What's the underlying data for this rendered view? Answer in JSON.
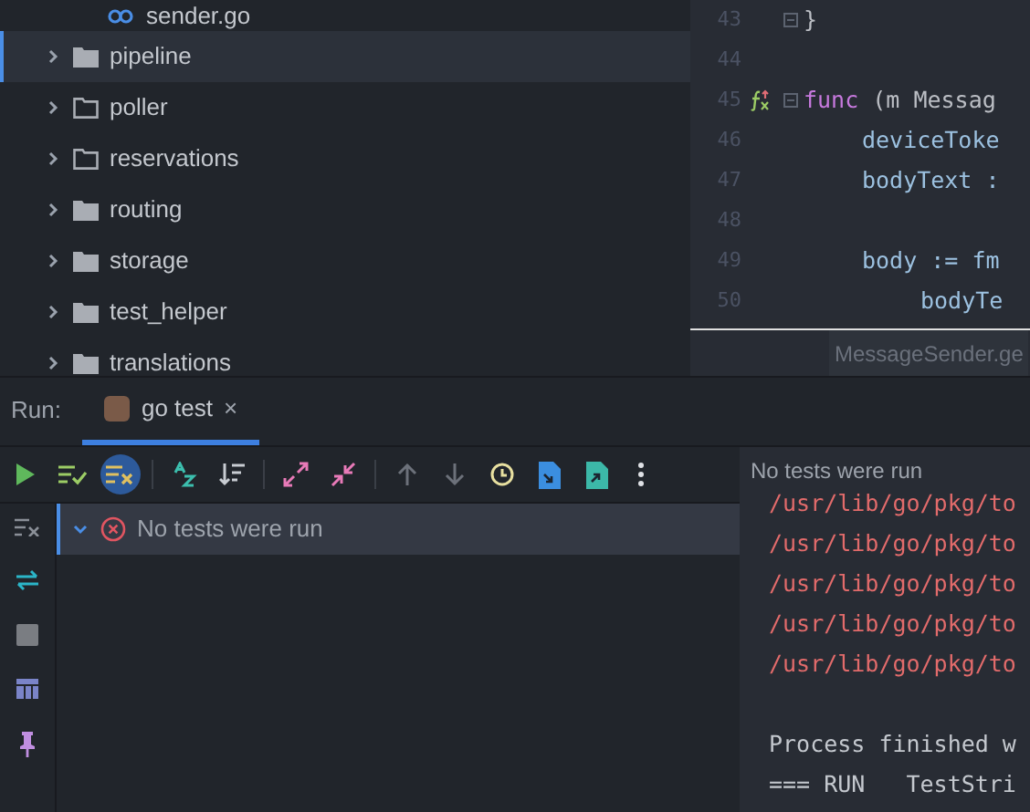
{
  "project_tree": {
    "items": [
      {
        "label": "sender.go",
        "kind": "file",
        "selected": false
      },
      {
        "label": "pipeline",
        "kind": "folder",
        "selected": true
      },
      {
        "label": "poller",
        "kind": "package",
        "selected": false
      },
      {
        "label": "reservations",
        "kind": "package",
        "selected": false
      },
      {
        "label": "routing",
        "kind": "folder",
        "selected": false
      },
      {
        "label": "storage",
        "kind": "folder",
        "selected": false
      },
      {
        "label": "test_helper",
        "kind": "folder",
        "selected": false
      },
      {
        "label": "translations",
        "kind": "folder",
        "selected": false
      }
    ]
  },
  "editor": {
    "lines": [
      {
        "number": "43",
        "segments": [
          {
            "kind": "plain",
            "text": "}"
          }
        ],
        "fold": true
      },
      {
        "number": "44"
      },
      {
        "number": "45",
        "segments": [
          {
            "kind": "keyword",
            "text": "func"
          },
          {
            "kind": "plain",
            "text": " (m Messag"
          }
        ],
        "fold": true,
        "gutter_icon": true,
        "children": [
          {
            "number": "46",
            "segments": [
              {
                "kind": "ident",
                "text": "deviceToke"
              }
            ]
          },
          {
            "number": "47",
            "segments": [
              {
                "kind": "ident",
                "text": "bodyText :"
              }
            ]
          },
          {
            "number": "48"
          },
          {
            "number": "49",
            "segments": [
              {
                "kind": "ident",
                "text": "body := fm"
              }
            ],
            "children": [
              {
                "number": "50",
                "segments": [
                  {
                    "kind": "ident",
                    "text": "bodyTe"
                  }
                ]
              }
            ]
          }
        ]
      }
    ],
    "breadcrumb": "MessageSender.ge"
  },
  "run_panel": {
    "label": "Run:",
    "tabs": [
      {
        "label": "go test",
        "selected": true,
        "close": "×"
      }
    ],
    "toolbar": [
      {
        "kind": "run",
        "active": false
      },
      {
        "kind": "passed",
        "active": false
      },
      {
        "kind": "failed",
        "active": true
      },
      {
        "kind": "sep"
      },
      {
        "kind": "sort-alpha",
        "active": false
      },
      {
        "kind": "sort-duration",
        "active": false
      },
      {
        "kind": "sep"
      },
      {
        "kind": "expand",
        "active": false
      },
      {
        "kind": "collapse",
        "active": false
      },
      {
        "kind": "sep"
      },
      {
        "kind": "up",
        "active": false
      },
      {
        "kind": "down",
        "active": false
      },
      {
        "kind": "history",
        "active": false
      },
      {
        "kind": "import",
        "active": false
      },
      {
        "kind": "export",
        "active": false
      },
      {
        "kind": "more",
        "active": false
      }
    ],
    "side_tools": [
      {
        "kind": "filter"
      },
      {
        "kind": "swap"
      },
      {
        "kind": "stop"
      },
      {
        "kind": "layout"
      },
      {
        "kind": "pin"
      }
    ],
    "test_tree": [
      {
        "label": "No tests were run",
        "expanded": true,
        "selected": true
      }
    ],
    "console": {
      "status": "No tests were run",
      "lines": [
        {
          "kind": "error",
          "text": "/usr/lib/go/pkg/to"
        },
        {
          "kind": "error",
          "text": "/usr/lib/go/pkg/to"
        },
        {
          "kind": "error",
          "text": "/usr/lib/go/pkg/to"
        },
        {
          "kind": "error",
          "text": "/usr/lib/go/pkg/to"
        },
        {
          "kind": "error",
          "text": "/usr/lib/go/pkg/to"
        },
        {
          "kind": "blank"
        },
        {
          "kind": "normal",
          "text": "Process finished w"
        },
        {
          "kind": "normal",
          "text": "=== RUN   TestStri"
        }
      ]
    }
  }
}
